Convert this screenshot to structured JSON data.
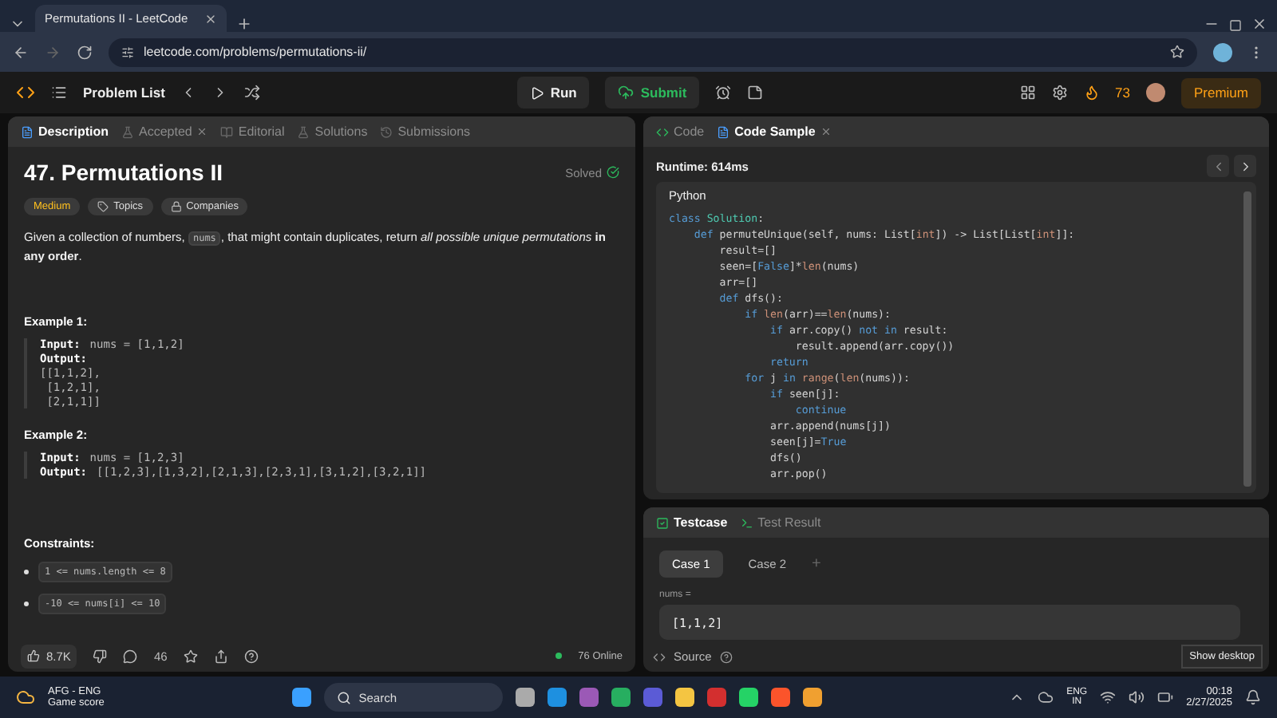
{
  "browser": {
    "tab_title": "Permutations II - LeetCode",
    "url": "leetcode.com/problems/permutations-ii/"
  },
  "nav": {
    "problem_list": "Problem List",
    "run": "Run",
    "submit": "Submit",
    "streak": "73",
    "premium": "Premium"
  },
  "left_tabs": [
    {
      "label": "Description",
      "selected": true,
      "closable": false
    },
    {
      "label": "Accepted",
      "selected": false,
      "closable": true
    },
    {
      "label": "Editorial",
      "selected": false,
      "closable": false
    },
    {
      "label": "Solutions",
      "selected": false,
      "closable": false
    },
    {
      "label": "Submissions",
      "selected": false,
      "closable": false
    }
  ],
  "problem": {
    "title": "47. Permutations II",
    "status": "Solved",
    "difficulty": "Medium",
    "tags": [
      "Topics",
      "Companies"
    ],
    "description": [
      {
        "kind": "text",
        "text": "Given a collection of numbers, "
      },
      {
        "kind": "code",
        "text": "nums"
      },
      {
        "kind": "text",
        "text": ", that might contain duplicates, return *all possible unique permutations* **in any order**."
      }
    ],
    "examples": [
      {
        "title": "Example 1:",
        "lines": [
          {
            "label": "Input:",
            "value": "nums = [1,1,2]"
          },
          {
            "label": "Output:"
          },
          {
            "value": "[[1,1,2],"
          },
          {
            "value": " [1,2,1],"
          },
          {
            "value": " [2,1,1]]"
          }
        ]
      },
      {
        "title": "Example 2:",
        "lines": [
          {
            "label": "Input:",
            "value": "nums = [1,2,3]"
          },
          {
            "label": "Output:",
            "value": "[[1,2,3],[1,3,2],[2,1,3],[2,3,1],[3,1,2],[3,2,1]]"
          }
        ]
      }
    ],
    "constraints_title": "Constraints:",
    "constraints": [
      "1 <= nums.length <= 8",
      "-10 <= nums[i] <= 10"
    ]
  },
  "footer": {
    "likes": "8.7K",
    "comments": "46",
    "online": "76 Online"
  },
  "right_tabs": [
    {
      "label": "Code",
      "selected": false,
      "closable": false
    },
    {
      "label": "Code Sample",
      "selected": true,
      "closable": true
    }
  ],
  "sample": {
    "runtime": "Runtime: 614ms",
    "language": "Python",
    "code": [
      [
        {
          "kind": "keyword",
          "t": "class "
        },
        {
          "kind": "class",
          "t": "Solution"
        },
        {
          "kind": "plain",
          "t": ":"
        }
      ],
      [
        {
          "kind": "keyword",
          "t": "    def "
        },
        {
          "kind": "plain",
          "t": "permuteUnique(self, nums: List["
        },
        {
          "kind": "builtin",
          "t": "int"
        },
        {
          "kind": "plain",
          "t": "]) -> List[List["
        },
        {
          "kind": "builtin",
          "t": "int"
        },
        {
          "kind": "plain",
          "t": "]]:"
        }
      ],
      [
        {
          "kind": "plain",
          "t": "        result=[]"
        }
      ],
      [
        {
          "kind": "plain",
          "t": "        seen=["
        },
        {
          "kind": "keyword",
          "t": "False"
        },
        {
          "kind": "plain",
          "t": "]*"
        },
        {
          "kind": "builtin",
          "t": "len"
        },
        {
          "kind": "plain",
          "t": "(nums)"
        }
      ],
      [
        {
          "kind": "plain",
          "t": "        arr=[]"
        }
      ],
      [
        {
          "kind": "keyword",
          "t": "        def "
        },
        {
          "kind": "plain",
          "t": "dfs():"
        }
      ],
      [
        {
          "kind": "keyword",
          "t": "            if "
        },
        {
          "kind": "builtin",
          "t": "len"
        },
        {
          "kind": "plain",
          "t": "(arr)=="
        },
        {
          "kind": "builtin",
          "t": "len"
        },
        {
          "kind": "plain",
          "t": "(nums):"
        }
      ],
      [
        {
          "kind": "keyword",
          "t": "                if "
        },
        {
          "kind": "plain",
          "t": "arr.copy() "
        },
        {
          "kind": "keyword",
          "t": "not in "
        },
        {
          "kind": "plain",
          "t": "result:"
        }
      ],
      [
        {
          "kind": "plain",
          "t": "                    result.append(arr.copy())"
        }
      ],
      [
        {
          "kind": "keyword",
          "t": "                return"
        }
      ],
      [
        {
          "kind": "keyword",
          "t": "            for "
        },
        {
          "kind": "plain",
          "t": "j "
        },
        {
          "kind": "keyword",
          "t": "in "
        },
        {
          "kind": "builtin",
          "t": "range"
        },
        {
          "kind": "plain",
          "t": "("
        },
        {
          "kind": "builtin",
          "t": "len"
        },
        {
          "kind": "plain",
          "t": "(nums)):"
        }
      ],
      [
        {
          "kind": "keyword",
          "t": "                if "
        },
        {
          "kind": "plain",
          "t": "seen[j]:"
        }
      ],
      [
        {
          "kind": "keyword",
          "t": "                    continue"
        }
      ],
      [
        {
          "kind": "plain",
          "t": "                arr.append(nums[j])"
        }
      ],
      [
        {
          "kind": "plain",
          "t": "                seen[j]="
        },
        {
          "kind": "keyword",
          "t": "True"
        }
      ],
      [
        {
          "kind": "plain",
          "t": "                dfs()"
        }
      ],
      [
        {
          "kind": "plain",
          "t": "                arr.pop()"
        }
      ]
    ]
  },
  "bottom_tabs": [
    {
      "label": "Testcase",
      "selected": true
    },
    {
      "label": "Test Result",
      "selected": false
    }
  ],
  "cases": [
    {
      "label": "Case 1",
      "selected": true
    },
    {
      "label": "Case 2",
      "selected": false
    }
  ],
  "add_case": "+",
  "input_label": "nums =",
  "input_value": "[1,1,2]",
  "source": "Source",
  "show_desktop": "Show desktop",
  "taskbar": {
    "weather_title": "AFG - ENG",
    "weather_sub": "Game score",
    "search": "Search",
    "lang": "ENG",
    "region": "IN",
    "time": "00:18",
    "date": "2/27/2025"
  }
}
